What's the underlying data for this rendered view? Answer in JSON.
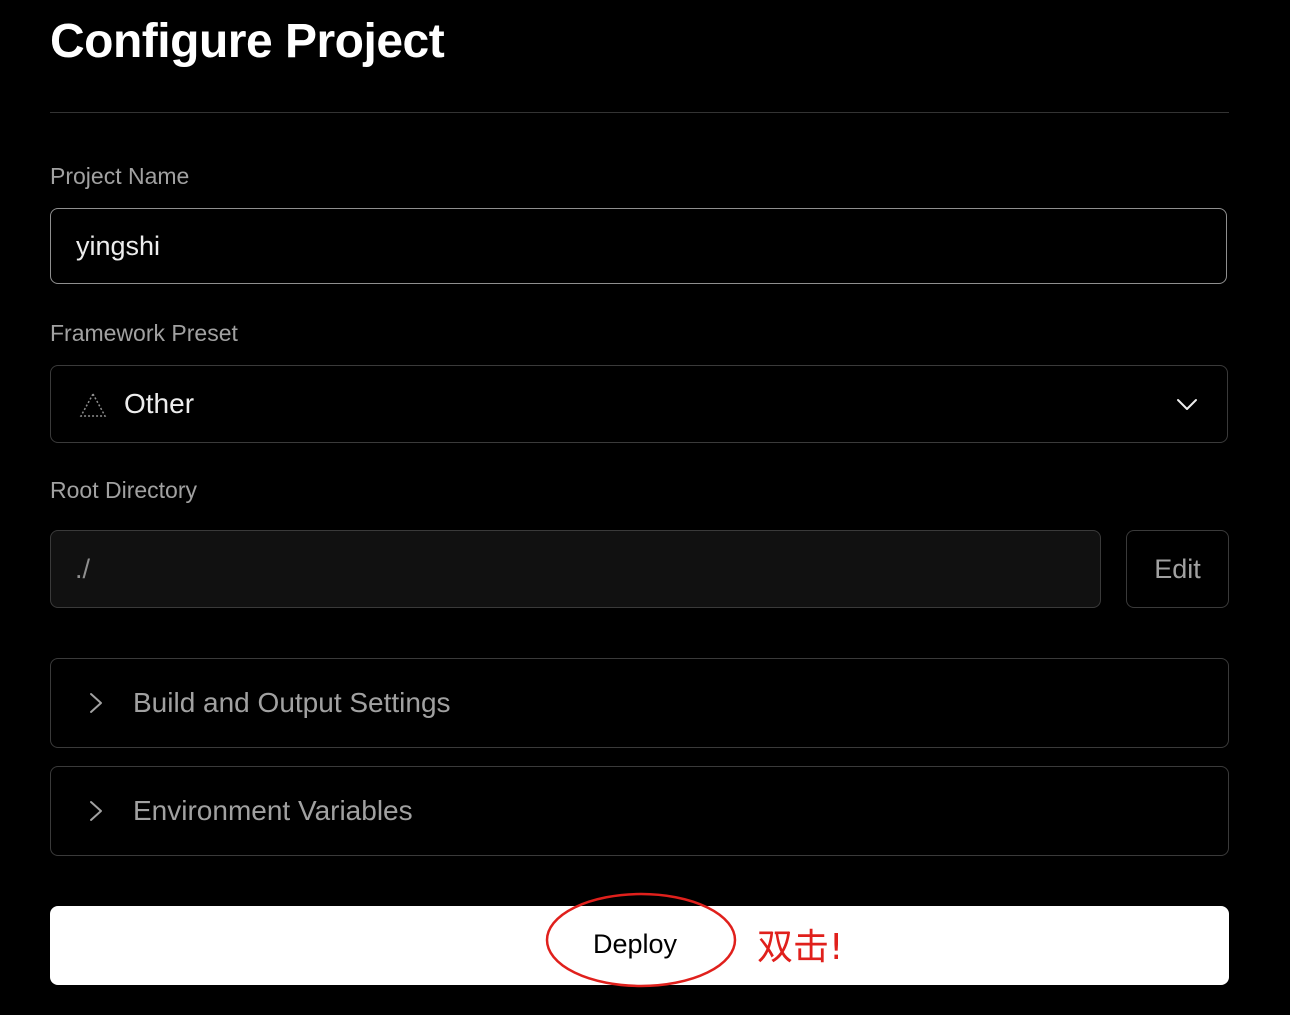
{
  "page": {
    "title": "Configure Project"
  },
  "form": {
    "project_name": {
      "label": "Project Name",
      "value": "yingshi"
    },
    "framework_preset": {
      "label": "Framework Preset",
      "value": "Other",
      "icon": "framework-other-icon"
    },
    "root_directory": {
      "label": "Root Directory",
      "value": "./",
      "edit_label": "Edit"
    }
  },
  "sections": [
    {
      "label": "Build and Output Settings",
      "icon": "chevron-right-icon"
    },
    {
      "label": "Environment Variables",
      "icon": "chevron-right-icon"
    }
  ],
  "actions": {
    "deploy_label": "Deploy"
  },
  "annotation": {
    "text": "双击!",
    "color": "#e0201c"
  },
  "colors": {
    "background": "#000000",
    "label": "#a1a1a1",
    "border": "#3a3a3a",
    "primary_button": "#ffffff"
  }
}
